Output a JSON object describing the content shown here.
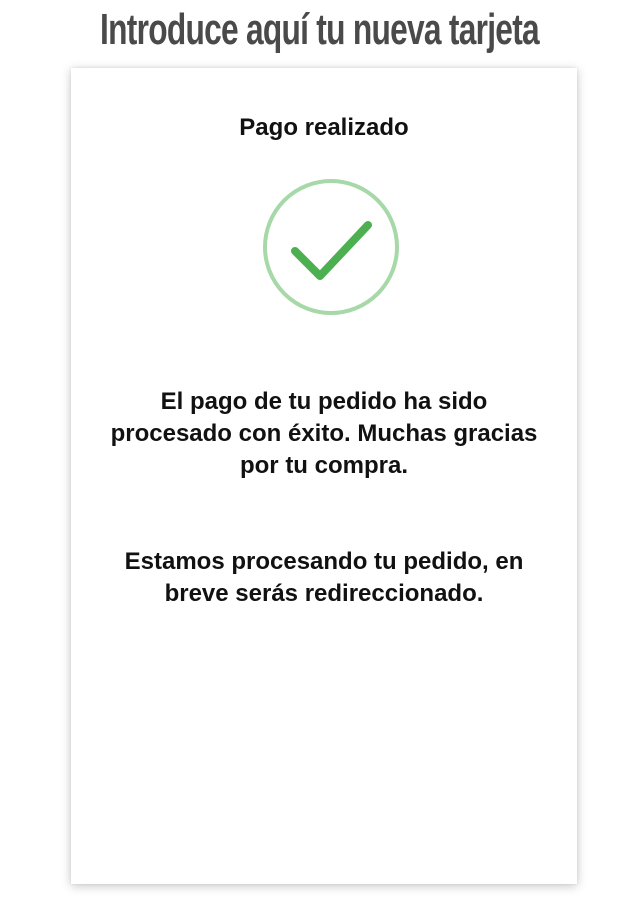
{
  "header": {
    "title": "Introduce aquí tu nueva tarjeta"
  },
  "card": {
    "heading": "Pago realizado",
    "success_icon": "check-circle-icon",
    "message_primary": "El pago de tu pedido ha sido procesado con éxito. Muchas gracias por tu compra.",
    "message_secondary": "Estamos procesando tu pedido, en breve serás redireccionado."
  },
  "colors": {
    "title_text": "#4a4a4a",
    "body_text": "#111111",
    "check_ring": "#a6d8a8",
    "check_mark": "#4caf50"
  }
}
